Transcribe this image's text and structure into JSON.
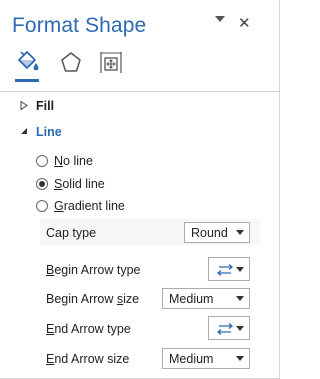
{
  "pane": {
    "title": "Format Shape",
    "pin_icon": "pin-dropdown-icon",
    "close_label": "✕"
  },
  "tabs": [
    {
      "name": "fill-line",
      "icon": "paint-bucket-icon",
      "active": true
    },
    {
      "name": "effects",
      "icon": "pentagon-icon",
      "active": false
    },
    {
      "name": "size-properties",
      "icon": "size-layout-icon",
      "active": false
    }
  ],
  "sections": {
    "fill": {
      "label": "Fill",
      "expanded": false
    },
    "line": {
      "label": "Line",
      "expanded": true
    }
  },
  "line_options": {
    "no_line": {
      "ul": "N",
      "rest": "o line",
      "checked": false
    },
    "solid_line": {
      "ul": "S",
      "rest": "olid line",
      "checked": true
    },
    "gradient_line": {
      "ul": "G",
      "rest": "radient line",
      "checked": false
    }
  },
  "properties": {
    "cap_type": {
      "label": "Cap type",
      "value": "Round"
    },
    "begin_arrow_type": {
      "pre": "",
      "ul": "B",
      "rest": "egin Arrow type"
    },
    "begin_arrow_size": {
      "pre": "Begin Arrow ",
      "ul": "s",
      "rest": "ize",
      "value": "Medium"
    },
    "end_arrow_type": {
      "pre": "",
      "ul": "E",
      "rest": "nd Arrow type"
    },
    "end_arrow_size": {
      "pre": "",
      "ul": "E",
      "rest": "nd Arrow size",
      "value": "Medium"
    }
  },
  "colors": {
    "accent": "#2e6ab4"
  }
}
